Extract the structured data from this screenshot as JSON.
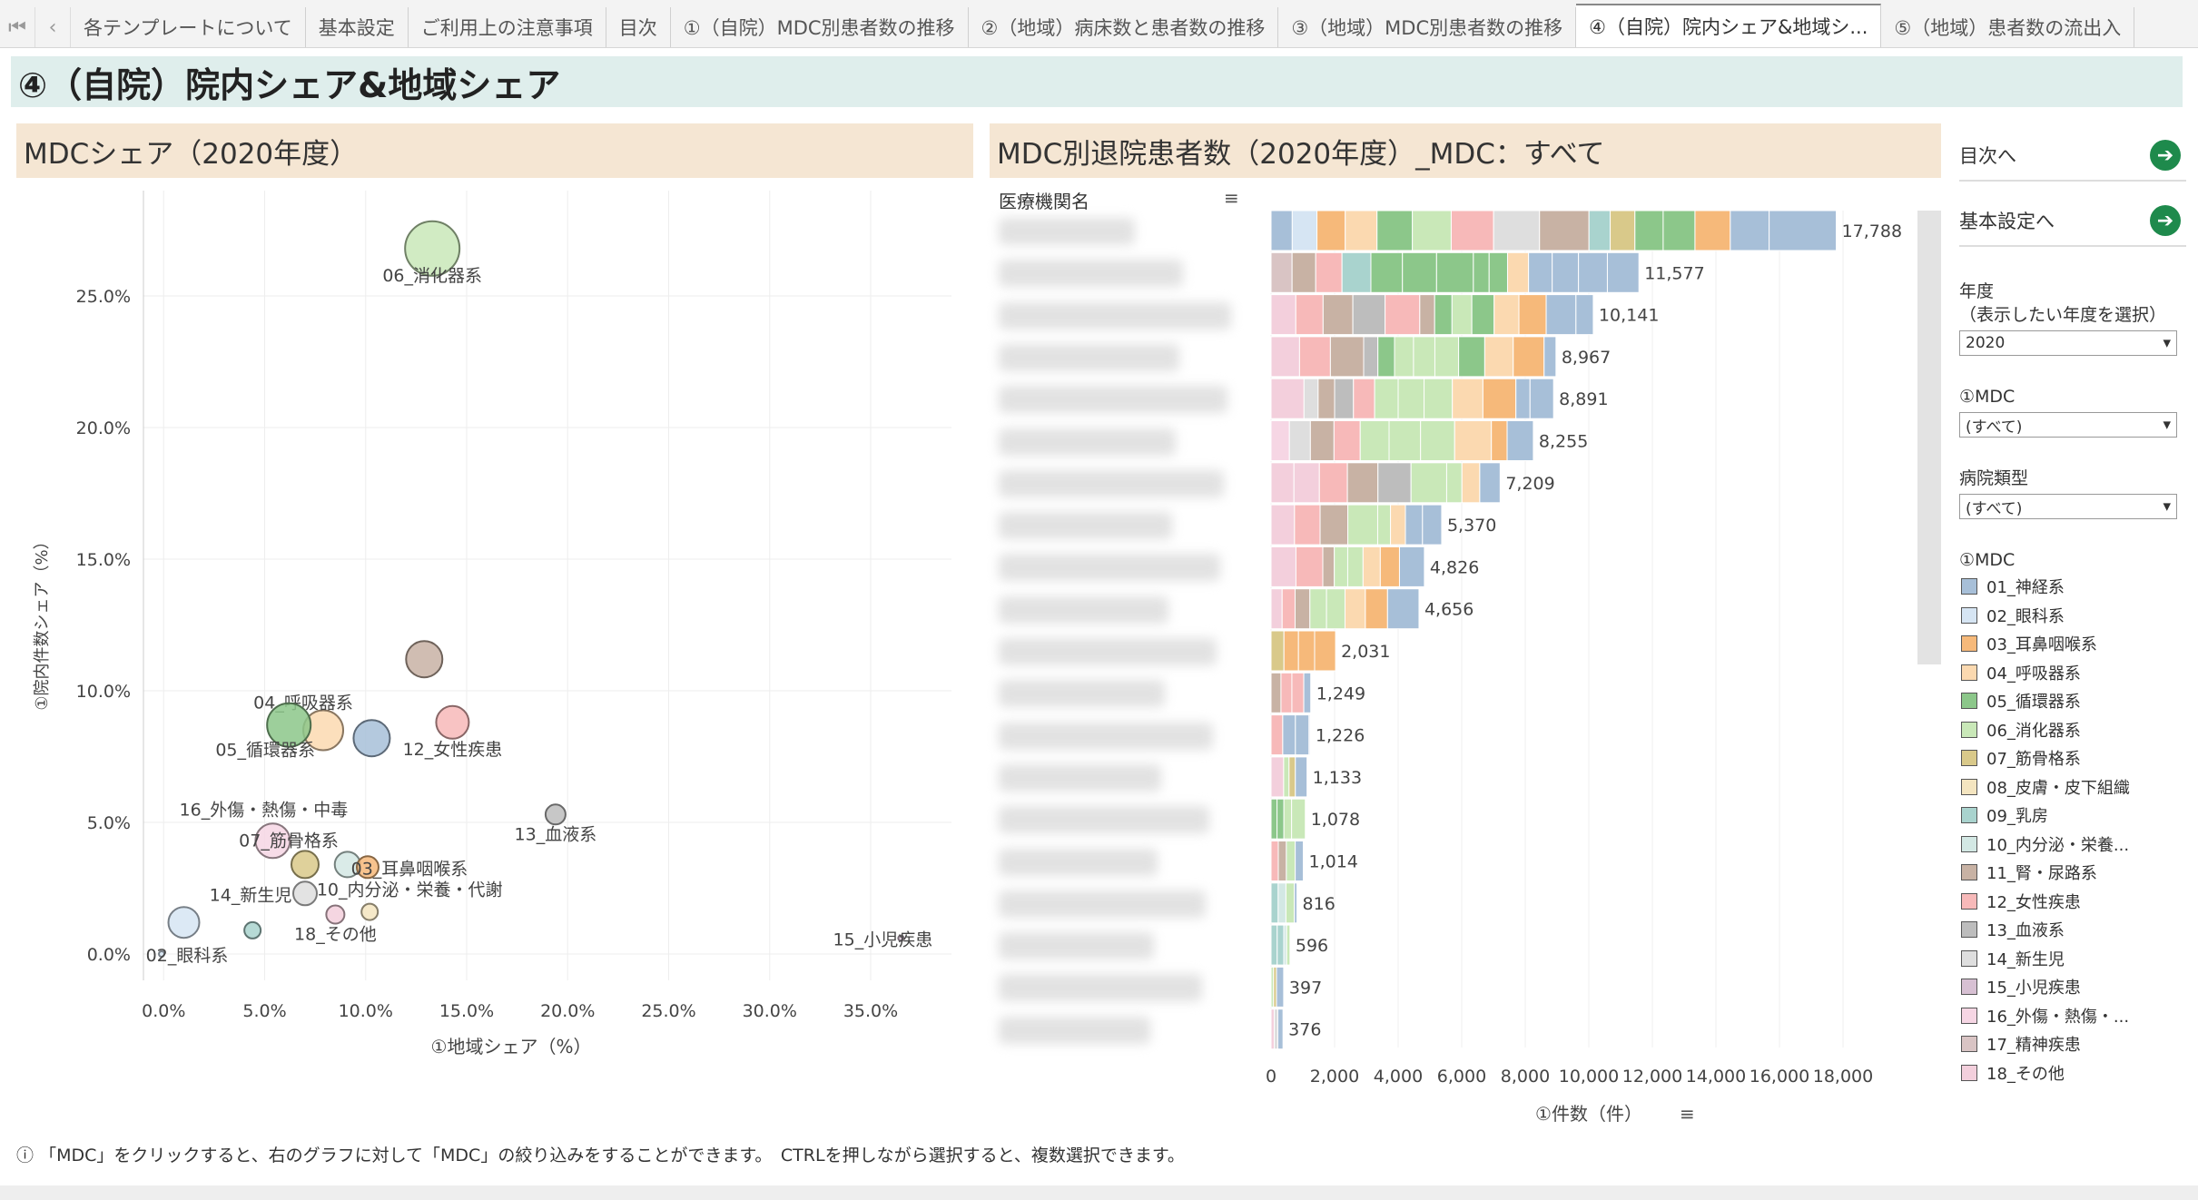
{
  "tabs": [
    "各テンプレートについて",
    "基本設定",
    "ご利用上の注意事項",
    "目次",
    "①（自院）MDC別患者数の推移",
    "②（地域）病床数と患者数の推移",
    "③（地域）MDC別患者数の推移",
    "④（自院）院内シェア&地域シ...",
    "⑤（地域）患者数の流出入"
  ],
  "active_tab": 7,
  "page_title": "④（自院）院内シェア&地域シェア",
  "left_panel_title": "MDCシェア（2020年度）",
  "right_panel_title": "MDC別退院患者数（2020年度）_MDC：すべて",
  "bar_header_label": "医療機関名",
  "nav": {
    "toc": "目次へ",
    "settings": "基本設定へ",
    "arrow": "➔"
  },
  "filters": {
    "year_label": "年度",
    "year_hint": "（表示したい年度を選択）",
    "year_value": "2020",
    "mdc_label": "①MDC",
    "mdc_value": "(すべて)",
    "type_label": "病院類型",
    "type_value": "(すべて)"
  },
  "legend_title": "①MDC",
  "legend": [
    {
      "label": "01_神経系",
      "color": "#a7bfd8"
    },
    {
      "label": "02_眼科系",
      "color": "#d6e5f3"
    },
    {
      "label": "03_耳鼻咽喉系",
      "color": "#f6b97a"
    },
    {
      "label": "04_呼吸器系",
      "color": "#fbd9b0"
    },
    {
      "label": "05_循環器系",
      "color": "#8cc78a"
    },
    {
      "label": "06_消化器系",
      "color": "#c9e8b8"
    },
    {
      "label": "07_筋骨格系",
      "color": "#d9c98a"
    },
    {
      "label": "08_皮膚・皮下組織",
      "color": "#f4e5c0"
    },
    {
      "label": "09_乳房",
      "color": "#a9d3ce"
    },
    {
      "label": "10_内分泌・栄養...",
      "color": "#d3e8e4"
    },
    {
      "label": "11_腎・尿路系",
      "color": "#c8b2a4"
    },
    {
      "label": "12_女性疾患",
      "color": "#f7b9b9"
    },
    {
      "label": "13_血液系",
      "color": "#bdbdbd"
    },
    {
      "label": "14_新生児",
      "color": "#dedede"
    },
    {
      "label": "15_小児疾患",
      "color": "#d7c0d3"
    },
    {
      "label": "16_外傷・熱傷・...",
      "color": "#f6d6e4"
    },
    {
      "label": "17_精神疾患",
      "color": "#d9c4c4"
    },
    {
      "label": "18_その他",
      "color": "#f3cfdc"
    }
  ],
  "footnote": "「MDC」をクリックすると、右のグラフに対して「MDC」の絞り込みをすることができます。　CTRLを押しながら選択すると、複数選択できます。",
  "chart_data": [
    {
      "type": "scatter",
      "title": "MDCシェア（2020年度）",
      "xlabel": "①地域シェア（%）",
      "ylabel": "①院内件数シェア（%）",
      "xlim": [
        -1,
        39
      ],
      "ylim": [
        -1,
        29
      ],
      "xticks": [
        "0.0%",
        "5.0%",
        "10.0%",
        "15.0%",
        "20.0%",
        "25.0%",
        "30.0%",
        "35.0%"
      ],
      "xtick_values": [
        0,
        5,
        10,
        15,
        20,
        25,
        30,
        35
      ],
      "yticks": [
        "0.0%",
        "5.0%",
        "10.0%",
        "15.0%",
        "20.0%",
        "25.0%"
      ],
      "ytick_values": [
        0,
        5,
        10,
        15,
        20,
        25
      ],
      "points": [
        {
          "label": "06_消化器系",
          "x": 13.3,
          "y": 26.8,
          "color": "#c9e8b8"
        },
        {
          "label": "",
          "x": 12.9,
          "y": 11.2,
          "color": "#c8b2a4"
        },
        {
          "label": "04_呼吸器系",
          "x": 7.9,
          "y": 8.5,
          "color": "#fbd9b0"
        },
        {
          "label": "05_循環器系",
          "x": 6.2,
          "y": 8.7,
          "color": "#8cc78a"
        },
        {
          "label": "",
          "x": 10.3,
          "y": 8.2,
          "color": "#a7bfd8"
        },
        {
          "label": "12_女性疾患",
          "x": 14.3,
          "y": 8.8,
          "color": "#f7b9b9"
        },
        {
          "label": "13_血液系",
          "x": 19.4,
          "y": 5.3,
          "color": "#bdbdbd"
        },
        {
          "label": "16_外傷・熱傷・中毒",
          "x": 5.4,
          "y": 4.3,
          "color": "#f6d6e4"
        },
        {
          "label": "07_筋骨格系",
          "x": 7.0,
          "y": 3.4,
          "color": "#d9c98a"
        },
        {
          "label": "",
          "x": 9.1,
          "y": 3.4,
          "color": "#d3e8e4"
        },
        {
          "label": "03_耳鼻咽喉系",
          "x": 10.1,
          "y": 3.3,
          "color": "#f6b97a"
        },
        {
          "label": "14_新生児",
          "x": 7.0,
          "y": 2.3,
          "color": "#dedede"
        },
        {
          "label": "10_内分泌・栄養・代謝",
          "x": 10.2,
          "y": 1.6,
          "color": "#f4e5c0"
        },
        {
          "label": "18_その他",
          "x": 8.5,
          "y": 1.5,
          "color": "#f3cfdc"
        },
        {
          "label": "",
          "x": 1.0,
          "y": 1.2,
          "color": "#d6e5f3"
        },
        {
          "label": "",
          "x": 4.4,
          "y": 0.9,
          "color": "#a9d3ce"
        },
        {
          "label": "02_眼科系",
          "x": -0.1,
          "y": 0.0,
          "color": "#d6e5f3"
        },
        {
          "label": "15_小児疾患",
          "x": 36.5,
          "y": 0.6,
          "color": "#d7c0d3"
        }
      ]
    },
    {
      "type": "bar",
      "orientation": "horizontal",
      "stacked": true,
      "title": "MDC別退院患者数（2020年度）_MDC：すべて",
      "xlabel": "①件数（件）",
      "xlim": [
        0,
        20000
      ],
      "xticks": [
        "0",
        "2,000",
        "4,000",
        "6,000",
        "8,000",
        "10,000",
        "12,000",
        "14,000",
        "16,000",
        "18,000"
      ],
      "xtick_values": [
        0,
        2000,
        4000,
        6000,
        8000,
        10000,
        12000,
        14000,
        16000,
        18000
      ],
      "values": [
        17788,
        11577,
        10141,
        8967,
        8891,
        8255,
        7209,
        5370,
        4826,
        4656,
        2031,
        1249,
        1226,
        1133,
        1078,
        1014,
        816,
        596,
        397,
        376
      ],
      "value_labels": [
        "17,788",
        "11,577",
        "10,141",
        "8,967",
        "8,891",
        "8,255",
        "7,209",
        "5,370",
        "4,826",
        "4,656",
        "2,031",
        "1,249",
        "1,226",
        "1,133",
        "1,078",
        "1,014",
        "816",
        "596",
        "397",
        "376"
      ]
    }
  ]
}
